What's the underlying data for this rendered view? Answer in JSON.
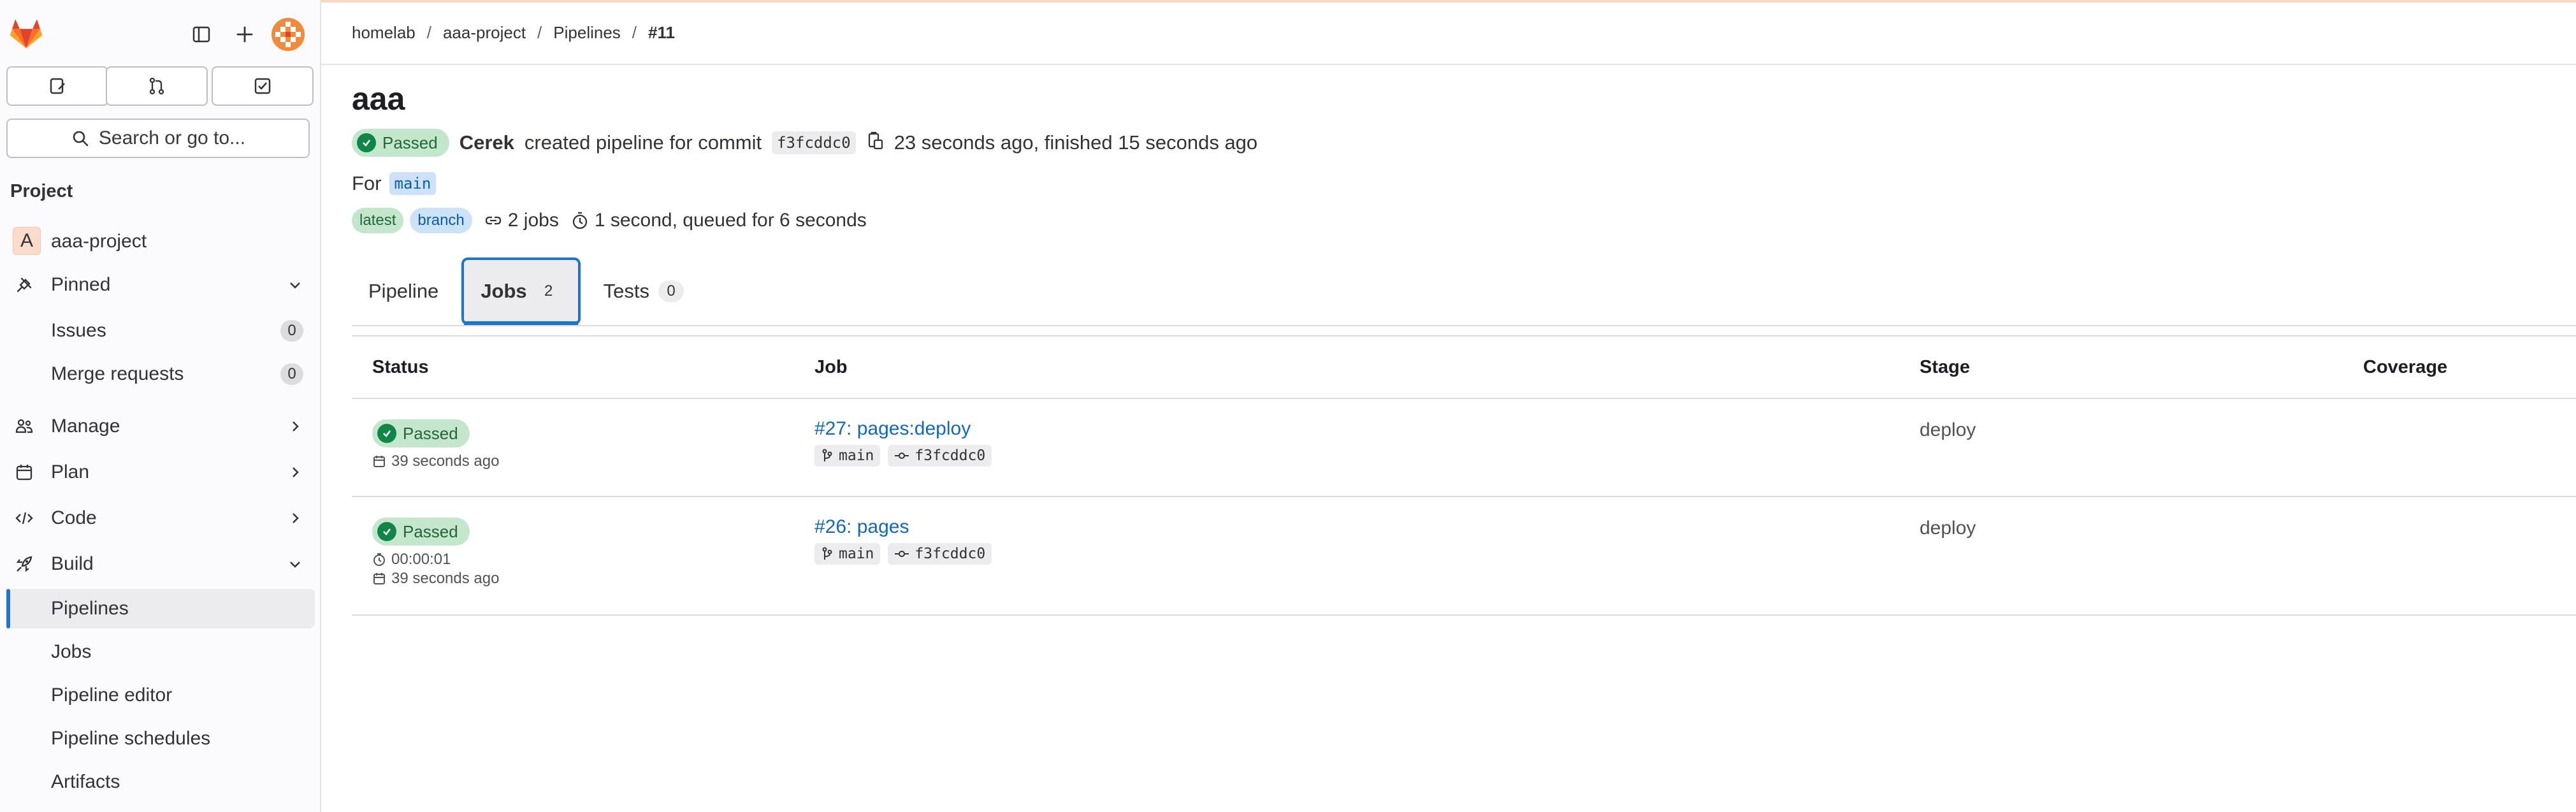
{
  "sidebar": {
    "section_title": "Project",
    "search_label": "Search or go to...",
    "project": {
      "avatar_letter": "A",
      "name": "aaa-project"
    },
    "pinned": {
      "label": "Pinned",
      "items": [
        {
          "label": "Issues",
          "count": "0"
        },
        {
          "label": "Merge requests",
          "count": "0"
        }
      ]
    },
    "groups": [
      {
        "label": "Manage",
        "icon": "users-icon"
      },
      {
        "label": "Plan",
        "icon": "calendar-icon"
      },
      {
        "label": "Code",
        "icon": "code-icon"
      }
    ],
    "build": {
      "label": "Build",
      "items": [
        {
          "label": "Pipelines",
          "active": true
        },
        {
          "label": "Jobs"
        },
        {
          "label": "Pipeline editor"
        },
        {
          "label": "Pipeline schedules"
        },
        {
          "label": "Artifacts"
        }
      ]
    }
  },
  "breadcrumb": [
    "homelab",
    "aaa-project",
    "Pipelines",
    "#11"
  ],
  "pipeline": {
    "title": "aaa",
    "status": "Passed",
    "author": "Cerek",
    "action_text": "created pipeline for commit",
    "commit_sha": "f3fcddc0",
    "timing": "23 seconds ago, finished 15 seconds ago",
    "for_label": "For",
    "ref": "main",
    "tags": [
      "latest",
      "branch"
    ],
    "jobs_count_text": "2 jobs",
    "duration_text": "1 second, queued for 6 seconds"
  },
  "tabs": [
    {
      "label": "Pipeline"
    },
    {
      "label": "Jobs",
      "count": "2",
      "active": true
    },
    {
      "label": "Tests",
      "count": "0"
    }
  ],
  "table": {
    "headers": {
      "status": "Status",
      "job": "Job",
      "stage": "Stage",
      "coverage": "Coverage"
    },
    "rows": [
      {
        "status": "Passed",
        "duration": "",
        "created": "39 seconds ago",
        "job": "#27: pages:deploy",
        "ref": "main",
        "sha": "f3fcddc0",
        "stage": "deploy"
      },
      {
        "status": "Passed",
        "duration": "00:00:01",
        "created": "39 seconds ago",
        "job": "#26: pages",
        "ref": "main",
        "sha": "f3fcddc0",
        "stage": "deploy"
      }
    ]
  },
  "colors": {
    "accent": "#1f75cb",
    "success": "#108548",
    "link": "#1068bf"
  }
}
